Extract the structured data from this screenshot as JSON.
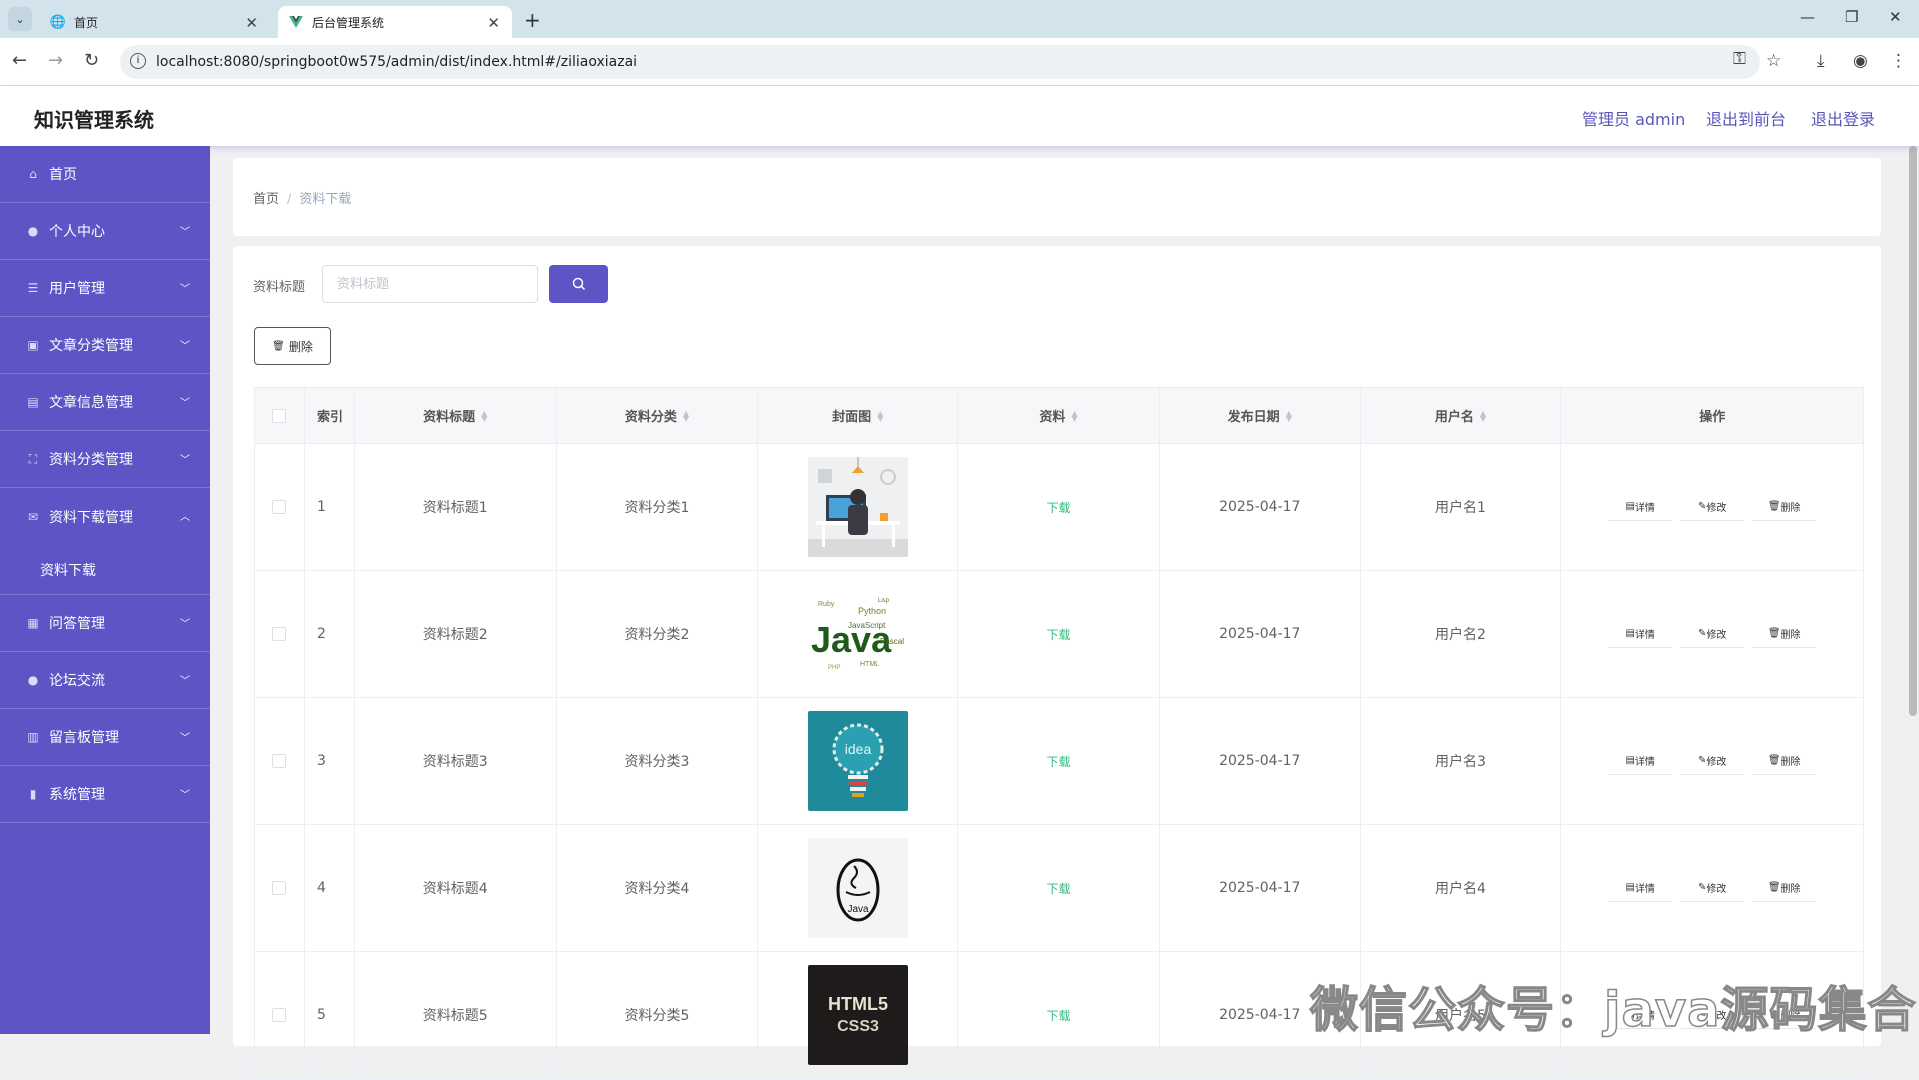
{
  "browser": {
    "tabs": [
      {
        "title": "首页",
        "active": false
      },
      {
        "title": "后台管理系统",
        "active": true
      }
    ],
    "url": "localhost:8080/springboot0w575/admin/dist/index.html#/ziliaoxiazai"
  },
  "header": {
    "title": "知识管理系统",
    "user": "管理员 admin",
    "to_front": "退出到前台",
    "logout": "退出登录"
  },
  "sidebar": {
    "items": [
      {
        "label": "首页",
        "icon": "home-icon",
        "has_arrow": false
      },
      {
        "label": "个人中心",
        "icon": "user-icon",
        "has_arrow": true
      },
      {
        "label": "用户管理",
        "icon": "menu-icon",
        "has_arrow": true
      },
      {
        "label": "文章分类管理",
        "icon": "picture-icon",
        "has_arrow": true
      },
      {
        "label": "文章信息管理",
        "icon": "document-icon",
        "has_arrow": true
      },
      {
        "label": "资料分类管理",
        "icon": "frame-icon",
        "has_arrow": true
      },
      {
        "label": "资料下载管理",
        "icon": "message-icon",
        "has_arrow": true,
        "expanded": true,
        "children": [
          "资料下载"
        ]
      },
      {
        "label": "问答管理",
        "icon": "grid-icon",
        "has_arrow": true
      },
      {
        "label": "论坛交流",
        "icon": "user-icon",
        "has_arrow": true
      },
      {
        "label": "留言板管理",
        "icon": "chart-icon",
        "has_arrow": true
      },
      {
        "label": "系统管理",
        "icon": "bar-chart-icon",
        "has_arrow": true
      }
    ]
  },
  "breadcrumb": {
    "home": "首页",
    "separator": "/",
    "current": "资料下载"
  },
  "search": {
    "label": "资料标题",
    "placeholder": "资料标题",
    "value": ""
  },
  "toolbar": {
    "delete_label": "删除"
  },
  "table": {
    "headers": {
      "index": "索引",
      "title": "资料标题",
      "category": "资料分类",
      "cover": "封面图",
      "file": "资料",
      "date": "发布日期",
      "user": "用户名",
      "ops": "操作"
    },
    "ops": {
      "detail": "详情",
      "edit": "修改",
      "delete": "删除"
    },
    "rows": [
      {
        "index": "1",
        "title": "资料标题1",
        "category": "资料分类1",
        "file": "下载",
        "date": "2025-04-17",
        "user": "用户名1",
        "cover": "office-worker-illustration"
      },
      {
        "index": "2",
        "title": "资料标题2",
        "category": "资料分类2",
        "file": "下载",
        "date": "2025-04-17",
        "user": "用户名2",
        "cover": "java-word-cloud"
      },
      {
        "index": "3",
        "title": "资料标题3",
        "category": "资料分类3",
        "file": "下载",
        "date": "2025-04-17",
        "user": "用户名3",
        "cover": "idea-lightbulb"
      },
      {
        "index": "4",
        "title": "资料标题4",
        "category": "资料分类4",
        "file": "下载",
        "date": "2025-04-17",
        "user": "用户名4",
        "cover": "java-logo"
      },
      {
        "index": "5",
        "title": "资料标题5",
        "category": "资料分类5",
        "file": "下载",
        "date": "2025-04-17",
        "user": "用户名5",
        "cover": "html5-css3-book"
      }
    ]
  },
  "watermark": "微信公众号：java源码集合",
  "colors": {
    "sidebar": "#5d55c5",
    "primary": "#5d55c5",
    "download": "#2dbd7a",
    "header_link": "#5a55b8"
  }
}
